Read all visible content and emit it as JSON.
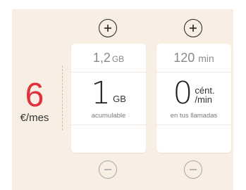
{
  "price": {
    "amount": "6",
    "unit": "€/mes",
    "color": "#e0323c"
  },
  "cards": [
    {
      "top_value": "1,2",
      "top_unit": "GB",
      "main_value": "1",
      "main_unit": "GB",
      "subtitle": "acumulable",
      "plus_icon": "plus-circle-icon",
      "minus_icon": "minus-circle-icon"
    },
    {
      "top_value": "120",
      "top_unit": "min",
      "main_value": "0",
      "main_unit_line1": "cént.",
      "main_unit_line2": "/min",
      "subtitle": "en tus llamadas",
      "plus_icon": "plus-circle-icon",
      "minus_icon": "minus-circle-icon"
    }
  ],
  "colors": {
    "panel_bg": "#f9eee3",
    "card_bg": "#ffffff"
  }
}
